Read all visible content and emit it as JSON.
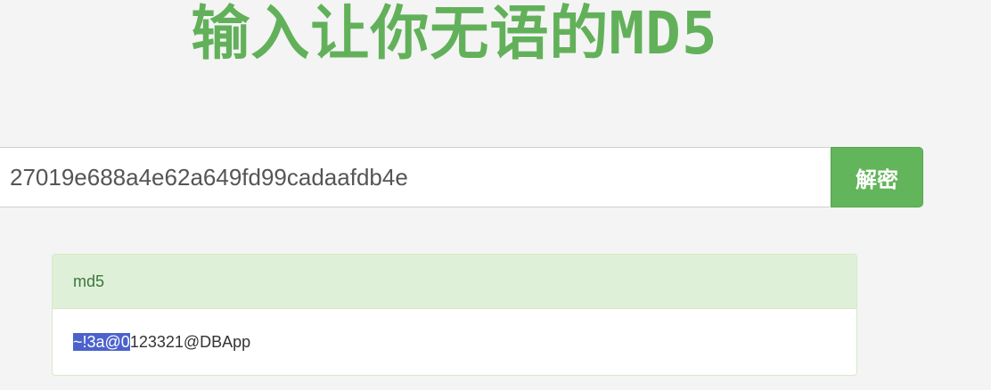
{
  "title": "输入让你无语的MD5",
  "search": {
    "value": "27019e688a4e62a649fd99cadaafdb4e",
    "button_label": "解密"
  },
  "result": {
    "heading": "md5",
    "value_selected": "~!3a@0",
    "value_rest": "123321@DBApp"
  },
  "colors": {
    "brand_green": "#62b15a",
    "button_green": "#62b55a",
    "panel_heading_bg": "#dff0d8",
    "selection_blue": "#4b62cc"
  }
}
